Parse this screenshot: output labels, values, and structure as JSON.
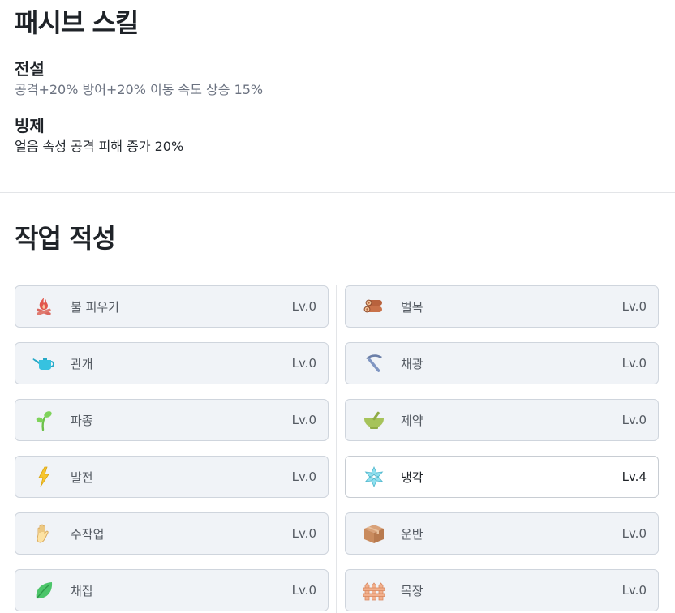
{
  "passive": {
    "title": "패시브 스킬",
    "skills": [
      {
        "name": "전설",
        "desc": "공격+20% 방어+20% 이동 속도 상승 15%"
      },
      {
        "name": "빙제",
        "desc": "얼음 속성 공격 피해 증가 20%"
      }
    ]
  },
  "jobs": {
    "title": "작업 적성",
    "items": [
      {
        "name": "불 피우기",
        "level": "Lv.0",
        "icon": "campfire-icon"
      },
      {
        "name": "벌목",
        "level": "Lv.0",
        "icon": "logs-icon"
      },
      {
        "name": "관개",
        "level": "Lv.0",
        "icon": "watering-can-icon"
      },
      {
        "name": "채광",
        "level": "Lv.0",
        "icon": "pickaxe-icon"
      },
      {
        "name": "파종",
        "level": "Lv.0",
        "icon": "sprout-icon"
      },
      {
        "name": "제약",
        "level": "Lv.0",
        "icon": "mortar-icon"
      },
      {
        "name": "발전",
        "level": "Lv.0",
        "icon": "lightning-icon"
      },
      {
        "name": "냉각",
        "level": "Lv.4",
        "icon": "snowflake-icon"
      },
      {
        "name": "수작업",
        "level": "Lv.0",
        "icon": "hand-icon"
      },
      {
        "name": "운반",
        "level": "Lv.0",
        "icon": "box-icon"
      },
      {
        "name": "채집",
        "level": "Lv.0",
        "icon": "leaf-icon"
      },
      {
        "name": "목장",
        "level": "Lv.0",
        "icon": "fence-icon"
      }
    ]
  }
}
